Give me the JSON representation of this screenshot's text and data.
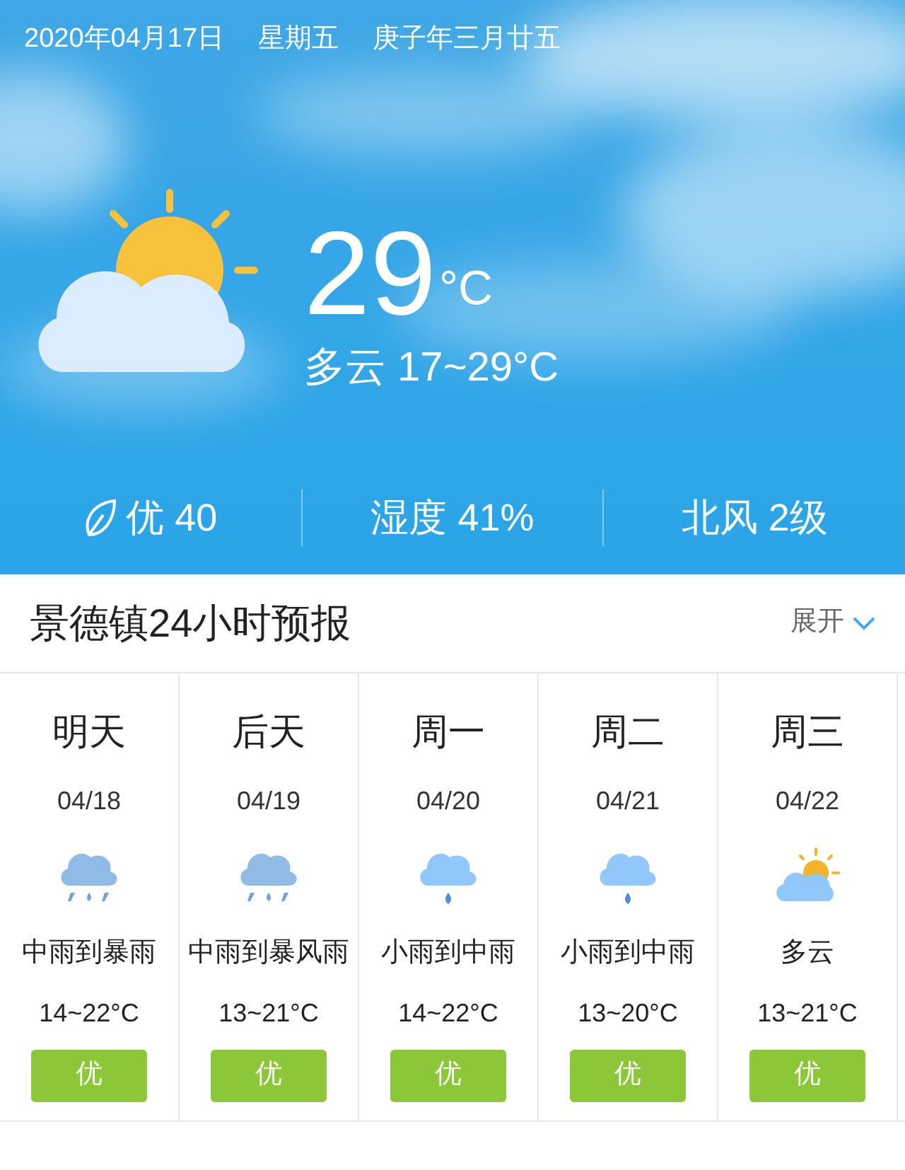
{
  "header": {
    "date": "2020年04月17日",
    "weekday": "星期五",
    "lunar": "庚子年三月廿五"
  },
  "current": {
    "kind": "partly_cloudy",
    "temperature": "29",
    "unit": "°C",
    "summary": "多云 17~29°C"
  },
  "stats": [
    {
      "kind": "air",
      "text": "优 40"
    },
    {
      "kind": "plain",
      "text": "湿度 41%"
    },
    {
      "kind": "plain",
      "text": "北风 2级"
    }
  ],
  "forecast": {
    "title": "景德镇24小时预报",
    "expand": "展开",
    "days": [
      {
        "day": "明天",
        "date": "04/18",
        "kind": "heavy_rain",
        "condition": "中雨到暴雨",
        "temp": "14~22°C",
        "air": "优"
      },
      {
        "day": "后天",
        "date": "04/19",
        "kind": "heavy_rain",
        "condition": "中雨到暴风雨",
        "temp": "13~21°C",
        "air": "优"
      },
      {
        "day": "周一",
        "date": "04/20",
        "kind": "light_rain",
        "condition": "小雨到中雨",
        "temp": "14~22°C",
        "air": "优"
      },
      {
        "day": "周二",
        "date": "04/21",
        "kind": "light_rain",
        "condition": "小雨到中雨",
        "temp": "13~20°C",
        "air": "优"
      },
      {
        "day": "周三",
        "date": "04/22",
        "kind": "partly_cloudy",
        "condition": "多云",
        "temp": "13~21°C",
        "air": "优"
      }
    ]
  }
}
